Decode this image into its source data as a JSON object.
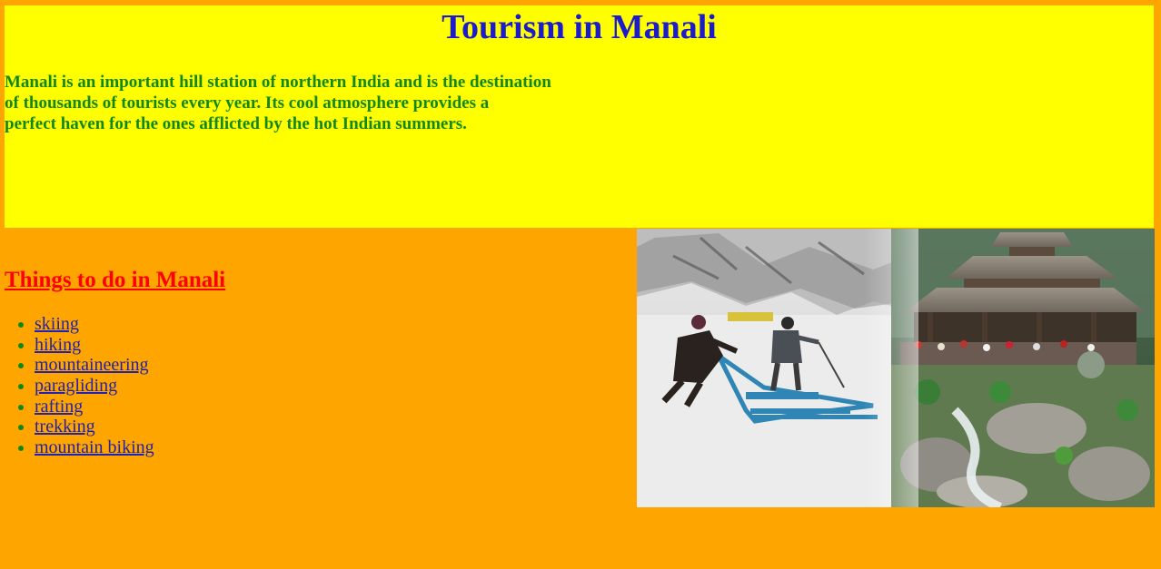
{
  "header": {
    "title": "Tourism in Manali",
    "intro_lines": [
      "Manali is an important hill station of northern India and is the destination",
      "of thousands of tourists every year. Its cool atmosphere provides a",
      "perfect haven for the ones afflicted by the hot Indian summers."
    ]
  },
  "things": {
    "heading": "Things to do in Manali",
    "items": [
      "skiing",
      "hiking",
      "mountaineering",
      "paragliding",
      "rafting",
      "trekking",
      "mountain biking"
    ]
  },
  "colors": {
    "page_background": "#ffa500",
    "header_background": "#ffff00",
    "title": "#1c1ccc",
    "intro_text": "#118811",
    "heading": "#ff0000",
    "link": "#2222aa",
    "bullet": "#118811"
  },
  "image": {
    "description_icon": "manali-collage-photo"
  }
}
